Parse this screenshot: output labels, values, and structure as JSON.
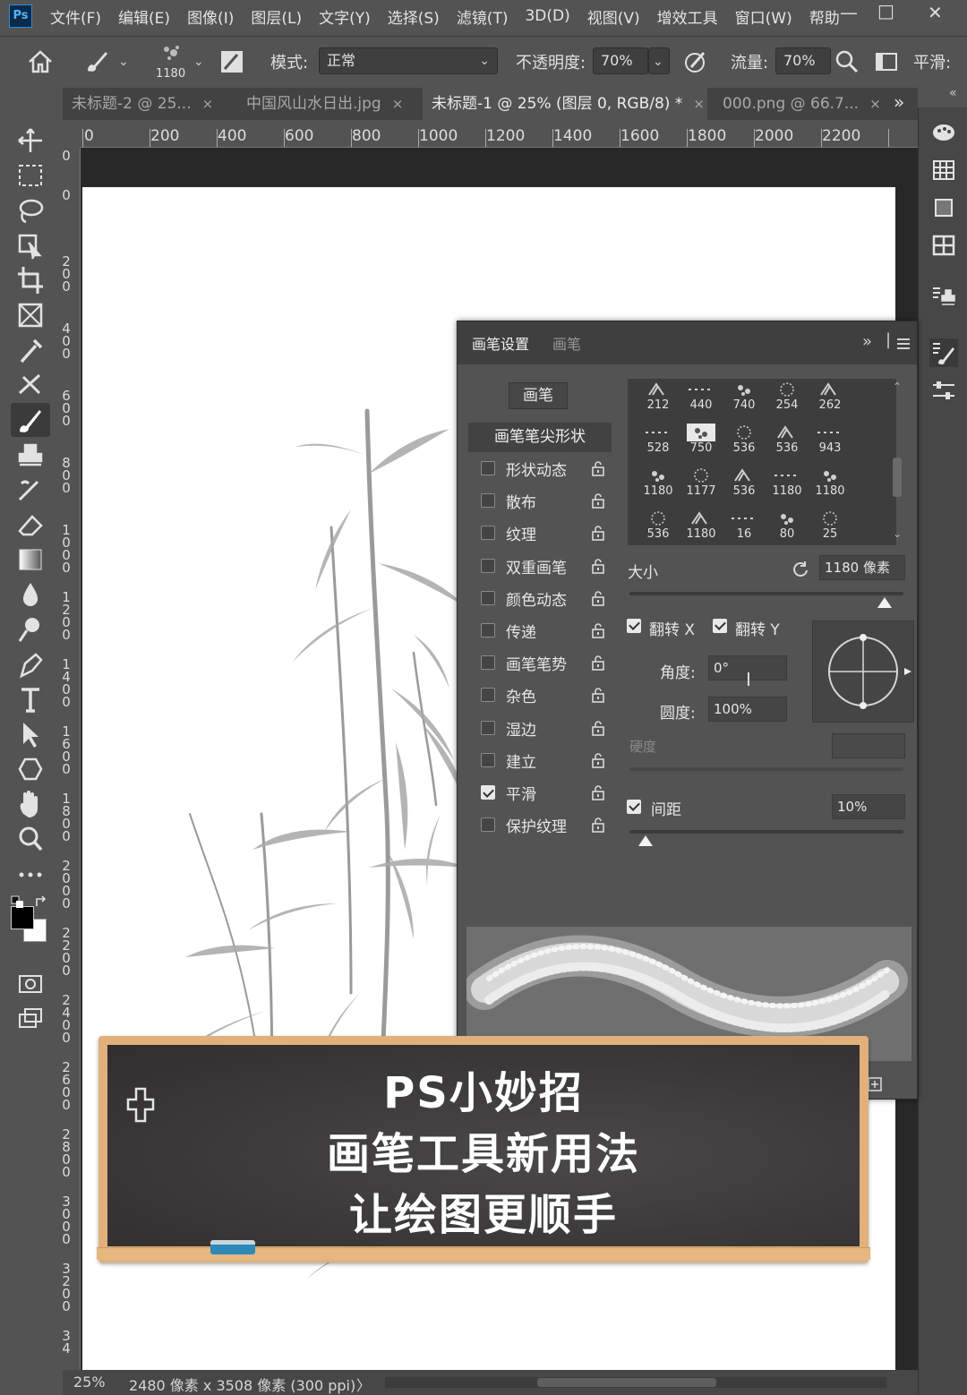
{
  "app": {
    "logo": "Ps"
  },
  "menu": [
    "文件(F)",
    "编辑(E)",
    "图像(I)",
    "图层(L)",
    "文字(Y)",
    "选择(S)",
    "滤镜(T)",
    "3D(D)",
    "视图(V)",
    "增效工具",
    "窗口(W)",
    "帮助"
  ],
  "window_controls": {
    "minimize": "—",
    "restore": "□",
    "close": "✕"
  },
  "options_bar": {
    "brush_size": "1180",
    "mode_label": "模式:",
    "mode_value": "正常",
    "opacity_label": "不透明度:",
    "opacity_value": "70%",
    "flow_label": "流量:",
    "flow_value": "70%",
    "smoothing_label": "平滑:"
  },
  "tabs": [
    {
      "label": "未标题-2 @ 25...",
      "close": "×"
    },
    {
      "label": "中国风山水日出.jpg",
      "close": "×"
    },
    {
      "label": "未标题-1 @ 25% (图层 0, RGB/8) *",
      "close": "×"
    },
    {
      "label": "000.png @ 66.7...",
      "close": "×"
    }
  ],
  "tabs_overflow": "»",
  "ruler": {
    "top": [
      "0",
      "200",
      "400",
      "600",
      "800",
      "1000",
      "1200",
      "1400",
      "1600",
      "1800",
      "2000",
      "2200"
    ],
    "left": [
      "0",
      "0",
      "200",
      "400",
      "600",
      "800",
      "1000",
      "1200",
      "1400",
      "1600",
      "1800",
      "2000",
      "2200",
      "2400",
      "2600",
      "2800",
      "3000",
      "3200",
      "34"
    ]
  },
  "brush_panel": {
    "tabs": [
      "画笔设置",
      "画笔"
    ],
    "brushes_button": "画笔",
    "tip_shape": "画笔笔尖形状",
    "options": [
      {
        "name": "形状动态",
        "checked": false
      },
      {
        "name": "散布",
        "checked": false
      },
      {
        "name": "纹理",
        "checked": false
      },
      {
        "name": "双重画笔",
        "checked": false
      },
      {
        "name": "颜色动态",
        "checked": false
      },
      {
        "name": "传递",
        "checked": false
      },
      {
        "name": "画笔笔势",
        "checked": false
      },
      {
        "name": "杂色",
        "checked": false
      },
      {
        "name": "湿边",
        "checked": false
      },
      {
        "name": "建立",
        "checked": false
      },
      {
        "name": "平滑",
        "checked": true
      },
      {
        "name": "保护纹理",
        "checked": false
      }
    ],
    "presets": [
      [
        "212",
        "440",
        "740",
        "254",
        "262"
      ],
      [
        "528",
        "750",
        "536",
        "536",
        "943"
      ],
      [
        "1180",
        "1177",
        "536",
        "1180",
        "1180"
      ],
      [
        "536",
        "1180",
        "16",
        "80",
        "25"
      ]
    ],
    "selected_preset": "750",
    "size_label": "大小",
    "size_value": "1180 像素",
    "size_fraction": 0.93,
    "flip_x_label": "翻转 X",
    "flip_y_label": "翻转 Y",
    "angle_label": "角度:",
    "angle_value": "0°",
    "roundness_label": "圆度:",
    "roundness_value": "100%",
    "hardness_label": "硬度",
    "spacing_label": "间距",
    "spacing_value": "10%",
    "spacing_fraction": 0.02
  },
  "status_bar": {
    "zoom": "25%",
    "doc_info": "2480 像素 x 3508 像素 (300 ppi)",
    "arrow": "〉"
  },
  "overlay": {
    "line1": "PS小妙招",
    "line2": "画笔工具新用法",
    "line3": "让绘图更顺手"
  },
  "colors": {
    "ui_bg": "#535353",
    "canvas_bg": "#ffffff",
    "board_frame": "#e2b07a",
    "board": "#3a3838",
    "ps_blue": "#4fb6ff"
  }
}
